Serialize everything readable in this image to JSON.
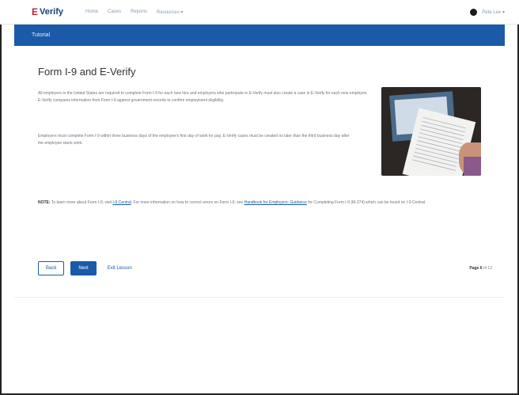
{
  "brand": {
    "logo_mark": "E",
    "logo_text": "Verify"
  },
  "nav": {
    "items": [
      "Home",
      "Cases",
      "Reports",
      "Resources ▾"
    ]
  },
  "user": {
    "label": "Pete Lee ▾"
  },
  "tutorial_bar": {
    "label": "Tutorial"
  },
  "content": {
    "title": "Form I-9 and E-Verify",
    "paragraph_1": "All employers in the United States are required to complete Form I-9 for each new hire and employers who participate in E-Verify must also create a case in E-Verify for each new employee. E-Verify compares information from Form I-9 against government records to confirm employment eligibility.",
    "paragraph_2": "Employers must complete Form I-9 within three business days of the employee's first day of work for pay. E-Verify cases must be created no later than the third business day after the employee starts work.",
    "note_label": "NOTE:",
    "note_text": "To learn more about Form I-9, visit",
    "note_link_1": "I-9 Central",
    "note_text_2": ". For more information on how to correct errors on Form I-9, see",
    "note_link_2": "Handbook for Employers: Guidance",
    "note_text_3": "for Completing Form I-9 (M-274) which can be found on I-9 Central."
  },
  "actions": {
    "back": "Back",
    "next": "Next",
    "exit": "Exit Lesson"
  },
  "pager": {
    "current": "Page 6",
    "total": "of 12"
  }
}
